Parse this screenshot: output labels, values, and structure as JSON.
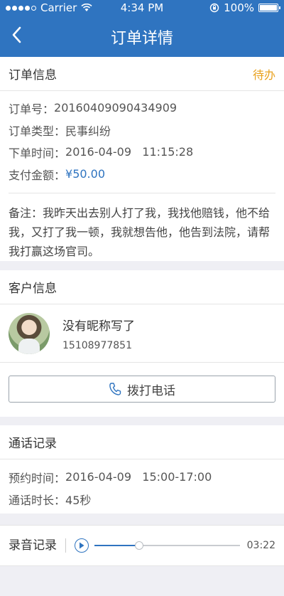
{
  "status": {
    "carrier": "Carrier",
    "time": "4:34 PM",
    "battery": "100%"
  },
  "nav": {
    "title": "订单详情"
  },
  "order": {
    "heading": "订单信息",
    "status": "待办",
    "rows": [
      {
        "label": "订单号：",
        "value": "20160409090434909"
      },
      {
        "label": "订单类型：",
        "value": "民事纠纷"
      },
      {
        "label": "下单时间：",
        "value": "2016-04-09   11:15:28"
      },
      {
        "label": "支付金额：",
        "value": "¥50.00"
      }
    ],
    "note": "备注：我昨天出去别人打了我，我找他赔钱，他不给我，又打了我一顿，我就想告他，他告到法院，请帮我打赢这场官司。"
  },
  "customer": {
    "heading": "客户信息",
    "name": "没有昵称写了",
    "phone": "15108977851",
    "call_label": "拨打电话"
  },
  "calls": {
    "heading": "通话记录",
    "rows": [
      {
        "label": "预约时间：",
        "value": "2016-04-09   15:00-17:00"
      },
      {
        "label": "通话时长：",
        "value": "45秒"
      }
    ]
  },
  "recording": {
    "label": "录音记录",
    "duration": "03:22",
    "progress": 0.31
  },
  "colors": {
    "brand": "#2f74c0",
    "pending": "#e9a11d"
  }
}
